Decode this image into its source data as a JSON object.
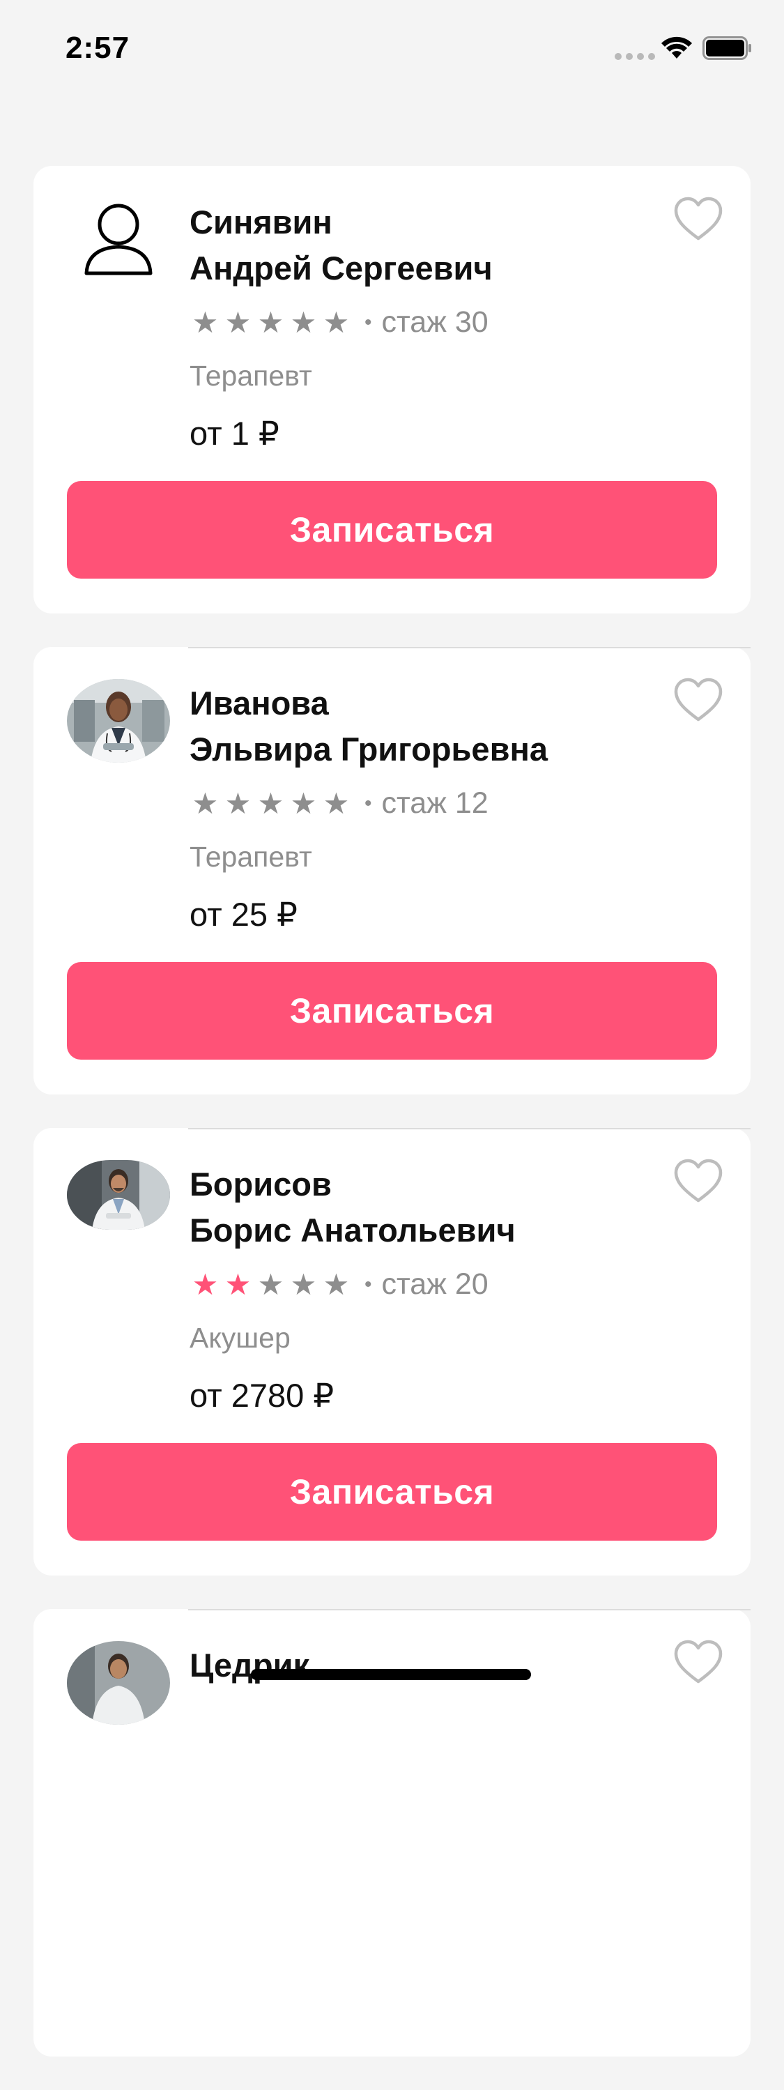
{
  "status_bar": {
    "time": "2:57",
    "icons": [
      "signal-dots-icon",
      "wifi-icon",
      "battery-icon"
    ]
  },
  "colors": {
    "accent": "#ff5277",
    "background": "#f4f4f4",
    "card": "#ffffff",
    "secondary_text": "#8e8e8e"
  },
  "doctors": [
    {
      "surname": "Синявин",
      "given_names": "Андрей Сергеевич",
      "avatar": "person-placeholder-icon",
      "rating": 0,
      "rating_max": 5,
      "experience": "стаж 30",
      "specialty": "Терапевт",
      "price": "от 1 ₽",
      "button_label": "Записаться",
      "favorite": false
    },
    {
      "surname": "Иванова",
      "given_names": "Эльвира Григорьевна",
      "avatar": "doctor-photo",
      "rating": 0,
      "rating_max": 5,
      "experience": "стаж 12",
      "specialty": "Терапевт",
      "price": "от 25 ₽",
      "button_label": "Записаться",
      "favorite": false
    },
    {
      "surname": "Борисов",
      "given_names": "Борис Анатольевич",
      "avatar": "doctor-photo",
      "rating": 2,
      "rating_max": 5,
      "experience": "стаж 20",
      "specialty": "Акушер",
      "price": "от 2780 ₽",
      "button_label": "Записаться",
      "favorite": false
    },
    {
      "surname": "Цедрик",
      "given_names": "",
      "avatar": "doctor-photo",
      "favorite": false
    }
  ]
}
